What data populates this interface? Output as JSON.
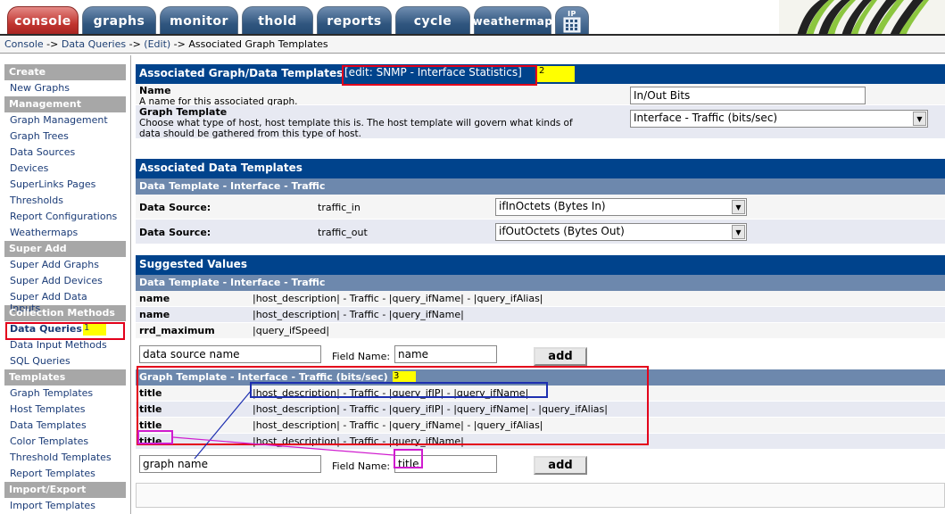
{
  "tabs": [
    {
      "label": "console",
      "style": "red"
    },
    {
      "label": "graphs",
      "style": "blue"
    },
    {
      "label": "monitor",
      "style": "blue"
    },
    {
      "label": "thold",
      "style": "blue"
    },
    {
      "label": "reports",
      "style": "blue"
    },
    {
      "label": "cycle",
      "style": "blue"
    },
    {
      "label": "weathermap",
      "style": "blue"
    },
    {
      "label": "IP",
      "style": "blue"
    }
  ],
  "breadcrumb": {
    "console": "Console",
    "sep1": " -> ",
    "data_queries": "Data Queries",
    "sep2": " -> ",
    "edit": "(Edit)",
    "sep3": " -> ",
    "current": "Associated Graph Templates"
  },
  "sidebar": {
    "sections": [
      {
        "header": "Create",
        "items": [
          "New Graphs"
        ]
      },
      {
        "header": "Management",
        "items": [
          "Graph Management",
          "Graph Trees",
          "Data Sources",
          "Devices",
          "SuperLinks Pages",
          "Thresholds",
          "Report Configurations",
          "Weathermaps"
        ]
      },
      {
        "header": "Super Add",
        "items": [
          "Super Add Graphs",
          "Super Add Devices",
          "Super Add Data Inputs"
        ]
      },
      {
        "header": "Collection Methods",
        "items": [
          "Data Queries",
          "Data Input Methods",
          "SQL Queries"
        ]
      },
      {
        "header": "Templates",
        "items": [
          "Graph Templates",
          "Host Templates",
          "Data Templates",
          "Color Templates",
          "Threshold Templates",
          "Report Templates"
        ]
      },
      {
        "header": "Import/Export",
        "items": [
          "Import Templates"
        ]
      }
    ],
    "active_item": "Data Queries"
  },
  "graph_data_templates": {
    "title": "Associated Graph/Data Templates",
    "edit_label": "[edit: SNMP - Interface Statistics]",
    "name_label": "Name",
    "name_desc": "A name for this associated graph.",
    "name_value": "In/Out Bits",
    "graph_template_label": "Graph Template",
    "graph_template_desc1": "Choose what type of host, host template this is. The host template will govern what kinds of",
    "graph_template_desc2": "data should be gathered from this type of host.",
    "graph_template_value": "Interface - Traffic (bits/sec)"
  },
  "data_templates": {
    "title": "Associated Data Templates",
    "subtitle": "Data Template - Interface - Traffic",
    "rows": [
      {
        "label": "Data Source:",
        "name": "traffic_in",
        "value": "ifInOctets (Bytes In)"
      },
      {
        "label": "Data Source:",
        "name": "traffic_out",
        "value": "ifOutOctets (Bytes Out)"
      }
    ]
  },
  "suggested_values": {
    "title": "Suggested Values",
    "ds_subtitle": "Data Template - Interface - Traffic",
    "ds_rows": [
      {
        "field": "name",
        "value": "|host_description| - Traffic - |query_ifName| - |query_ifAlias|"
      },
      {
        "field": "name",
        "value": "|host_description| - Traffic - |query_ifName|"
      },
      {
        "field": "rrd_maximum",
        "value": "|query_ifSpeed|"
      }
    ],
    "ds_input_value": "data source name",
    "ds_field_name_label": "Field Name:",
    "ds_field_name_value": "name",
    "add_label": "add",
    "gt_subtitle": "Graph Template - Interface - Traffic (bits/sec)",
    "gt_rows": [
      {
        "field": "title",
        "value": "|host_description| - Traffic - |query_ifIP| - |query_ifName|"
      },
      {
        "field": "title",
        "value": "|host_description| - Traffic - |query_ifIP| - |query_ifName| - |query_ifAlias|"
      },
      {
        "field": "title",
        "value": "|host_description| - Traffic - |query_ifName| - |query_ifAlias|"
      },
      {
        "field": "title",
        "value": "|host_description| - Traffic - |query_ifName|"
      }
    ],
    "gt_input_value": "graph name",
    "gt_field_name_label": "Field Name:",
    "gt_field_name_value": "title"
  },
  "annotations": {
    "marker1": "1",
    "marker2": "2",
    "marker3": "3"
  },
  "colors": {
    "accent": "#00438c",
    "subhead": "#6d88ad",
    "highlight_red": "#e3001b",
    "highlight_yellow": "#ffff00",
    "highlight_blue": "#1d2fb0",
    "highlight_magenta": "#d01ccf"
  }
}
